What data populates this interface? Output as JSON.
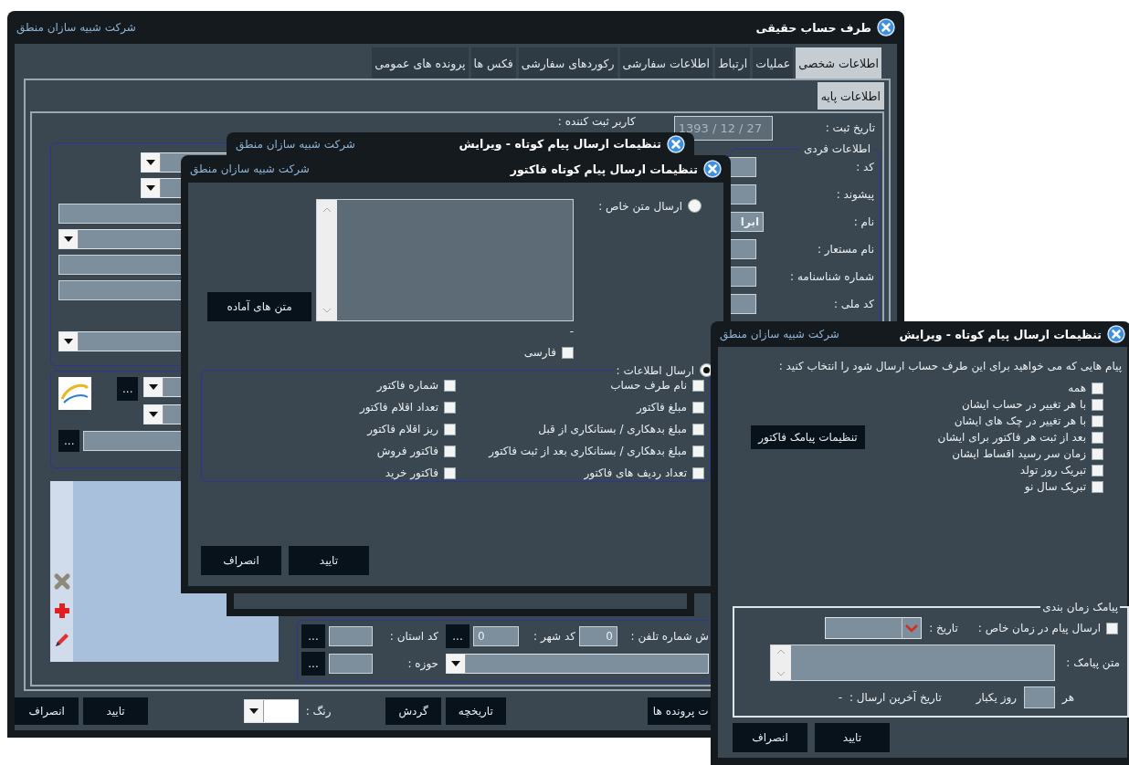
{
  "main_window": {
    "title": "طرف حساب حقیقی",
    "company": "شرکت شبیه سازان منطق",
    "tabs": [
      {
        "label": "اطلاعات شخصی",
        "selected": true
      },
      {
        "label": "عملیات",
        "selected": false
      },
      {
        "label": "ارتباط",
        "selected": false
      },
      {
        "label": "اطلاعات سفارشی",
        "selected": false
      },
      {
        "label": "رکوردهای سفارشی",
        "selected": false
      },
      {
        "label": "فکس ها",
        "selected": false
      },
      {
        "label": "پرونده های عمومی",
        "selected": false
      }
    ],
    "subtabs": [
      {
        "label": "اطلاعات پایه",
        "selected": true
      }
    ],
    "registration_date": {
      "label": "تاریخ ثبت :",
      "value": "1393 / 12 / 27"
    },
    "registered_by": {
      "label": "کاربر ثبت کننده :"
    },
    "personal_info": {
      "legend": "اطلاعات فردی",
      "fields": [
        {
          "label": "کد :"
        },
        {
          "label": "پیشوند :"
        },
        {
          "label": "نام :",
          "value": "ابرا"
        },
        {
          "label": "نام مستعار :"
        },
        {
          "label": "شماره شناسنامه :"
        },
        {
          "label": "کد ملی :"
        }
      ]
    },
    "more_buttons": [
      "...",
      "..."
    ],
    "address": {
      "phone_label": "ش شماره تلفن :",
      "phone_value": "0",
      "city_label": "کد شهر :",
      "city_value": "0",
      "city_more": "...",
      "province_label": "کد استان :",
      "province_more": "...",
      "zone_label": "حوزه :",
      "zone_more": "..."
    },
    "bottom_bar": [
      {
        "kind": "button",
        "label": "ت پرونده ها"
      },
      {
        "kind": "button",
        "label": "تاریخچه"
      },
      {
        "kind": "button",
        "label": "گردش"
      },
      {
        "kind": "color",
        "label": "رنگ :"
      },
      {
        "kind": "button",
        "label": "تایید"
      },
      {
        "kind": "button",
        "label": "انصراف"
      }
    ]
  },
  "edit_window_behind": {
    "title": "تنظیمات ارسال پیام کوتاه - ویرایش",
    "company": "شرکت شبیه سازان منطق"
  },
  "invoice_sms_window": {
    "title": "تنظیمات ارسال پیام کوتاه فاکتور",
    "company": "شرکت شبیه سازان منطق",
    "custom_text": {
      "label": "ارسال متن خاص :",
      "selected": false
    },
    "ready_texts_button": "متن های آماده",
    "counter": "-",
    "persian": {
      "label": "فارسی",
      "checked": false
    },
    "send_info": {
      "label": "ارسال اطلاعات :",
      "selected": true
    },
    "info_fields": [
      {
        "label": "نام طرف حساب",
        "checked": false
      },
      {
        "label": "شماره فاکتور",
        "checked": false
      },
      {
        "label": "مبلغ فاکتور",
        "checked": false
      },
      {
        "label": "تعداد اقلام فاکتور",
        "checked": false
      },
      {
        "label": "مبلغ بدهکاری / بستانکاری از قبل",
        "checked": false
      },
      {
        "label": "ریز اقلام فاکتور",
        "checked": false
      },
      {
        "label": "مبلغ بدهکاری / بستانکاری بعد از ثبت فاکتور",
        "checked": false
      },
      {
        "label": "فاکتور فروش",
        "checked": false
      },
      {
        "label": "تعداد ردیف های فاکتور",
        "checked": false
      },
      {
        "label": "فاکتور خرید",
        "checked": false
      }
    ],
    "buttons": [
      "تایید",
      "انصراف"
    ]
  },
  "edit_window": {
    "title": "تنظیمات ارسال پیام کوتاه - ویرایش",
    "company": "شرکت شبیه سازان منطق",
    "prompt": "پیام هایی که می خواهید برای این طرف حساب ارسال شود را انتخاب کنید :",
    "message_types": [
      {
        "label": "همه",
        "checked": false
      },
      {
        "label": "با هر تغییر در حساب ایشان",
        "checked": false
      },
      {
        "label": "با هر تغییر در چک های ایشان",
        "checked": false
      },
      {
        "label": "بعد از ثبت هر فاکتور برای ایشان",
        "checked": false
      },
      {
        "label": "زمان سر رسید اقساط ایشان",
        "checked": false
      },
      {
        "label": "تبریک روز تولد",
        "checked": false
      },
      {
        "label": "تبریک سال نو",
        "checked": false
      }
    ],
    "invoice_settings_button": "تنظیمات پیامک فاکتور",
    "schedule": {
      "legend": "پیامک زمان بندی",
      "specific_time": {
        "label": "ارسال پیام در زمان خاص :",
        "checked": false
      },
      "date_label": "تاریخ :",
      "text_label": "متن پیامک :",
      "every_label": "هر",
      "days_label": "روز یکبار",
      "last_sent_label": "تاریخ آخرین ارسال :",
      "last_sent_value": "-"
    },
    "buttons": [
      "تایید",
      "انصراف"
    ]
  }
}
